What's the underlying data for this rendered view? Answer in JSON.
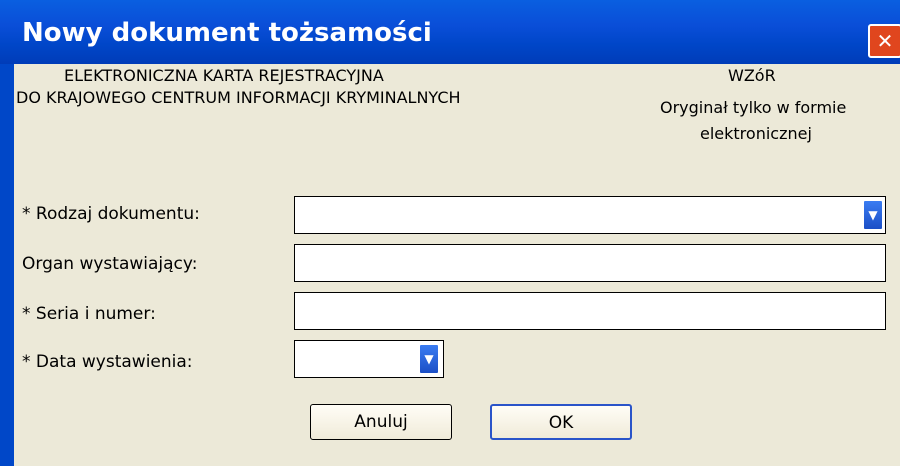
{
  "window": {
    "title": "Nowy dokument tożsamości",
    "close_label": "✕"
  },
  "header": {
    "left_line1": "ELEKTRONICZNA KARTA REJESTRACYJNA",
    "left_line2": "DO KRAJOWEGO CENTRUM INFORMACJI KRYMINALNYCH",
    "right_line1": "WZóR",
    "right_line2": "Oryginał tylko w formie",
    "right_line3": "elektronicznej"
  },
  "form": {
    "rodzaj_label": "* Rodzaj dokumentu:",
    "organ_label": "Organ wystawiający:",
    "seria_label": "* Seria i numer:",
    "data_label": "* Data wystawienia:"
  },
  "buttons": {
    "cancel": "Anuluj",
    "ok": "OK"
  },
  "colors": {
    "titlebar": "#0a4ed8",
    "window_bg": "#ece9d8",
    "close": "#e0461e"
  }
}
